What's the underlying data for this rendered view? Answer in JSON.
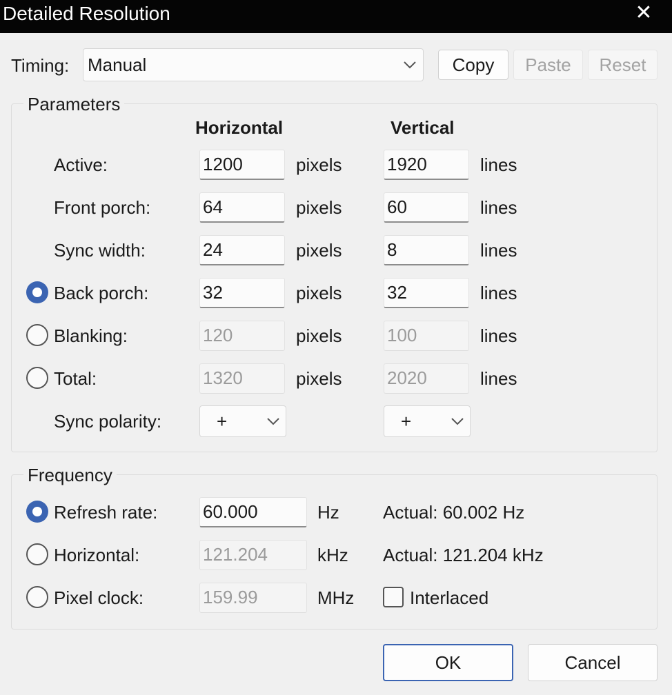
{
  "window": {
    "title": "Detailed Resolution",
    "close_glyph": "✕"
  },
  "timing": {
    "label": "Timing:",
    "value": "Manual"
  },
  "toolbar": {
    "copy": "Copy",
    "paste": "Paste",
    "reset": "Reset"
  },
  "parameters": {
    "title": "Parameters",
    "col_horizontal": "Horizontal",
    "col_vertical": "Vertical",
    "rows": {
      "active": {
        "label": "Active:",
        "h": "1200",
        "h_unit": "pixels",
        "v": "1920",
        "v_unit": "lines"
      },
      "front": {
        "label": "Front porch:",
        "h": "64",
        "h_unit": "pixels",
        "v": "60",
        "v_unit": "lines"
      },
      "sync": {
        "label": "Sync width:",
        "h": "24",
        "h_unit": "pixels",
        "v": "8",
        "v_unit": "lines"
      },
      "back": {
        "label": "Back porch:",
        "h": "32",
        "h_unit": "pixels",
        "v": "32",
        "v_unit": "lines"
      },
      "blanking": {
        "label": "Blanking:",
        "h": "120",
        "h_unit": "pixels",
        "v": "100",
        "v_unit": "lines"
      },
      "total": {
        "label": "Total:",
        "h": "1320",
        "h_unit": "pixels",
        "v": "2020",
        "v_unit": "lines"
      }
    },
    "sync_polarity": {
      "label": "Sync polarity:",
      "h": "+",
      "v": "+"
    },
    "selected_mode": "back-porch"
  },
  "frequency": {
    "title": "Frequency",
    "refresh": {
      "label": "Refresh rate:",
      "value": "60.000",
      "unit": "Hz",
      "actual": "Actual: 60.002 Hz"
    },
    "horizontal": {
      "label": "Horizontal:",
      "value": "121.204",
      "unit": "kHz",
      "actual": "Actual: 121.204 kHz"
    },
    "pixel_clock": {
      "label": "Pixel clock:",
      "value": "159.99",
      "unit": "MHz"
    },
    "interlaced": {
      "label": "Interlaced",
      "checked": false
    },
    "selected_mode": "refresh-rate"
  },
  "footer": {
    "ok": "OK",
    "cancel": "Cancel"
  },
  "colors": {
    "accent": "#3b64b2",
    "titlebar": "#050505",
    "background": "#f0f0f0"
  },
  "icons": [
    "close-icon",
    "chevron-down-icon"
  ]
}
